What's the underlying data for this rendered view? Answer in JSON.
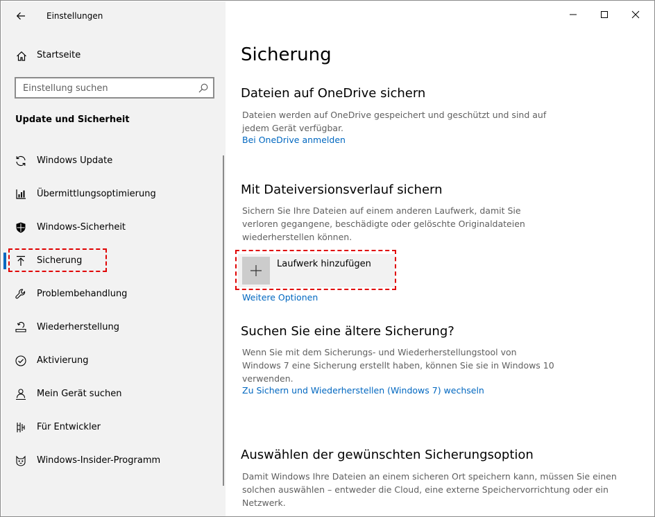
{
  "window": {
    "title": "Einstellungen"
  },
  "sidebar": {
    "home_label": "Startseite",
    "search_placeholder": "Einstellung suchen",
    "section_title": "Update und Sicherheit",
    "items": [
      {
        "label": "Windows Update",
        "icon": "refresh-icon"
      },
      {
        "label": "Übermittlungsoptimierung",
        "icon": "delivery-optimization-icon"
      },
      {
        "label": "Windows-Sicherheit",
        "icon": "shield-icon"
      },
      {
        "label": "Sicherung",
        "icon": "backup-arrow-icon",
        "active": true
      },
      {
        "label": "Problembehandlung",
        "icon": "wrench-icon"
      },
      {
        "label": "Wiederherstellung",
        "icon": "recovery-icon"
      },
      {
        "label": "Aktivierung",
        "icon": "checkmark-circle-icon"
      },
      {
        "label": "Mein Gerät suchen",
        "icon": "person-pin-icon"
      },
      {
        "label": "Für Entwickler",
        "icon": "developer-icon"
      },
      {
        "label": "Windows-Insider-Programm",
        "icon": "insider-cat-icon"
      }
    ]
  },
  "main": {
    "page_title": "Sicherung",
    "onedrive": {
      "heading": "Dateien auf OneDrive sichern",
      "description": "Dateien werden auf OneDrive gespeichert und geschützt und sind auf jedem Gerät verfügbar.",
      "link": "Bei OneDrive anmelden"
    },
    "file_history": {
      "heading": "Mit Dateiversionsverlauf sichern",
      "description": "Sichern Sie Ihre Dateien auf einem anderen Laufwerk, damit Sie verloren gegangene, beschädigte oder gelöschte Originaldateien wiederherstellen können.",
      "add_drive_label": "Laufwerk hinzufügen",
      "more_options_link": "Weitere Optionen"
    },
    "older_backup": {
      "heading": "Suchen Sie eine ältere Sicherung?",
      "description": "Wenn Sie mit dem Sicherungs- und Wiederherstellungstool von Windows 7 eine Sicherung erstellt haben, können Sie sie in Windows 10 verwenden.",
      "link": "Zu Sichern und Wiederherstellen (Windows 7) wechseln"
    },
    "choose_option": {
      "heading": "Auswählen der gewünschten Sicherungsoption",
      "description": "Damit Windows Ihre Dateien an einem sicheren Ort speichern kann, müssen Sie einen solchen auswählen – entweder die Cloud, eine externe Speichervorrichtung oder ein Netzwerk."
    }
  },
  "colors": {
    "accent": "#0067c0",
    "sidebar_bg": "#f2f2f2",
    "highlight": "#e00000"
  }
}
